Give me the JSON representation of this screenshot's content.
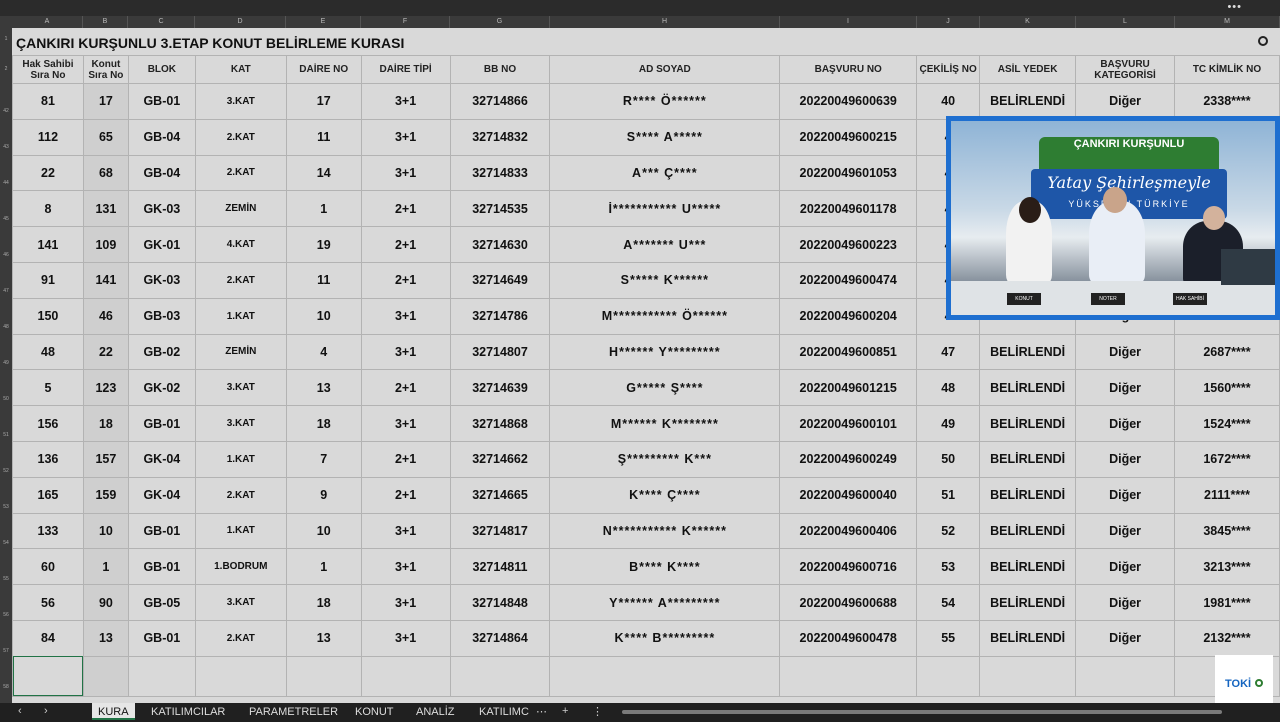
{
  "window": {
    "menu_dots": "•••"
  },
  "sheet_title": "ÇANKIRI KURŞUNLU 3.ETAP KONUT BELİRLEME KURASI",
  "column_letters": [
    "A",
    "B",
    "C",
    "D",
    "E",
    "F",
    "G",
    "H",
    "I",
    "J",
    "K",
    "L",
    "M"
  ],
  "row_numbers": [
    "1",
    "2",
    "42",
    "43",
    "44",
    "45",
    "46",
    "47",
    "48",
    "49",
    "50",
    "51",
    "52",
    "53",
    "54",
    "55",
    "56",
    "57",
    "58"
  ],
  "headers": [
    "Hak Sahibi Sıra No",
    "Konut Sıra No",
    "BLOK",
    "KAT",
    "DAİRE NO",
    "DAİRE TİPİ",
    "BB NO",
    "AD SOYAD",
    "BAŞVURU NO",
    "ÇEKİLİŞ NO",
    "ASİL YEDEK",
    "BAŞVURU KATEGORİSİ",
    "TC KİMLİK NO"
  ],
  "rows": [
    {
      "hak": "81",
      "konut": "17",
      "blok": "GB-01",
      "kat": "3.KAT",
      "daire": "17",
      "tip": "3+1",
      "bb": "32714866",
      "ad": "R**** Ö******",
      "basvuru": "20220049600639",
      "cekilis": "40",
      "asil": "BELİRLENDİ",
      "kategori": "Diğer",
      "tc": "2338****"
    },
    {
      "hak": "112",
      "konut": "65",
      "blok": "GB-04",
      "kat": "2.KAT",
      "daire": "11",
      "tip": "3+1",
      "bb": "32714832",
      "ad": "S**** A*****",
      "basvuru": "20220049600215",
      "cekilis": "4",
      "asil": "",
      "kategori": "",
      "tc": ""
    },
    {
      "hak": "22",
      "konut": "68",
      "blok": "GB-04",
      "kat": "2.KAT",
      "daire": "14",
      "tip": "3+1",
      "bb": "32714833",
      "ad": "A*** Ç****",
      "basvuru": "20220049601053",
      "cekilis": "4",
      "asil": "",
      "kategori": "",
      "tc": ""
    },
    {
      "hak": "8",
      "konut": "131",
      "blok": "GK-03",
      "kat": "ZEMİN",
      "daire": "1",
      "tip": "2+1",
      "bb": "32714535",
      "ad": "İ*********** U*****",
      "basvuru": "20220049601178",
      "cekilis": "4",
      "asil": "",
      "kategori": "",
      "tc": ""
    },
    {
      "hak": "141",
      "konut": "109",
      "blok": "GK-01",
      "kat": "4.KAT",
      "daire": "19",
      "tip": "2+1",
      "bb": "32714630",
      "ad": "A******* U***",
      "basvuru": "20220049600223",
      "cekilis": "4",
      "asil": "",
      "kategori": "",
      "tc": ""
    },
    {
      "hak": "91",
      "konut": "141",
      "blok": "GK-03",
      "kat": "2.KAT",
      "daire": "11",
      "tip": "2+1",
      "bb": "32714649",
      "ad": "S***** K******",
      "basvuru": "20220049600474",
      "cekilis": "4",
      "asil": "",
      "kategori": "",
      "tc": ""
    },
    {
      "hak": "150",
      "konut": "46",
      "blok": "GB-03",
      "kat": "1.KAT",
      "daire": "10",
      "tip": "3+1",
      "bb": "32714786",
      "ad": "M*********** Ö******",
      "basvuru": "20220049600204",
      "cekilis": "4",
      "asil": "",
      "kategori": "Diğer",
      "tc": ""
    },
    {
      "hak": "48",
      "konut": "22",
      "blok": "GB-02",
      "kat": "ZEMİN",
      "daire": "4",
      "tip": "3+1",
      "bb": "32714807",
      "ad": "H****** Y*********",
      "basvuru": "20220049600851",
      "cekilis": "47",
      "asil": "BELİRLENDİ",
      "kategori": "Diğer",
      "tc": "2687****"
    },
    {
      "hak": "5",
      "konut": "123",
      "blok": "GK-02",
      "kat": "3.KAT",
      "daire": "13",
      "tip": "2+1",
      "bb": "32714639",
      "ad": "G***** Ş****",
      "basvuru": "20220049601215",
      "cekilis": "48",
      "asil": "BELİRLENDİ",
      "kategori": "Diğer",
      "tc": "1560****"
    },
    {
      "hak": "156",
      "konut": "18",
      "blok": "GB-01",
      "kat": "3.KAT",
      "daire": "18",
      "tip": "3+1",
      "bb": "32714868",
      "ad": "M****** K********",
      "basvuru": "20220049600101",
      "cekilis": "49",
      "asil": "BELİRLENDİ",
      "kategori": "Diğer",
      "tc": "1524****"
    },
    {
      "hak": "136",
      "konut": "157",
      "blok": "GK-04",
      "kat": "1.KAT",
      "daire": "7",
      "tip": "2+1",
      "bb": "32714662",
      "ad": "Ş********* K***",
      "basvuru": "20220049600249",
      "cekilis": "50",
      "asil": "BELİRLENDİ",
      "kategori": "Diğer",
      "tc": "1672****"
    },
    {
      "hak": "165",
      "konut": "159",
      "blok": "GK-04",
      "kat": "2.KAT",
      "daire": "9",
      "tip": "2+1",
      "bb": "32714665",
      "ad": "K**** Ç****",
      "basvuru": "20220049600040",
      "cekilis": "51",
      "asil": "BELİRLENDİ",
      "kategori": "Diğer",
      "tc": "2111****"
    },
    {
      "hak": "133",
      "konut": "10",
      "blok": "GB-01",
      "kat": "1.KAT",
      "daire": "10",
      "tip": "3+1",
      "bb": "32714817",
      "ad": "N*********** K******",
      "basvuru": "20220049600406",
      "cekilis": "52",
      "asil": "BELİRLENDİ",
      "kategori": "Diğer",
      "tc": "3845****"
    },
    {
      "hak": "60",
      "konut": "1",
      "blok": "GB-01",
      "kat": "1.BODRUM",
      "daire": "1",
      "tip": "3+1",
      "bb": "32714811",
      "ad": "B**** K****",
      "basvuru": "20220049600716",
      "cekilis": "53",
      "asil": "BELİRLENDİ",
      "kategori": "Diğer",
      "tc": "3213****"
    },
    {
      "hak": "56",
      "konut": "90",
      "blok": "GB-05",
      "kat": "3.KAT",
      "daire": "18",
      "tip": "3+1",
      "bb": "32714848",
      "ad": "Y****** A*********",
      "basvuru": "20220049600688",
      "cekilis": "54",
      "asil": "BELİRLENDİ",
      "kategori": "Diğer",
      "tc": "1981****"
    },
    {
      "hak": "84",
      "konut": "13",
      "blok": "GB-01",
      "kat": "2.KAT",
      "daire": "13",
      "tip": "3+1",
      "bb": "32714864",
      "ad": "K**** B*********",
      "basvuru": "20220049600478",
      "cekilis": "55",
      "asil": "BELİRLENDİ",
      "kategori": "Diğer",
      "tc": "2132****"
    }
  ],
  "video": {
    "banner_title": "ÇANKIRI KURŞUNLU",
    "slogan": "Yatay Şehirleşmeyle",
    "subtitle": "YÜKSELEN TÜRKİYE",
    "tags": [
      "KONUT",
      "NOTER",
      "HAK SAHİBİ"
    ]
  },
  "logo": "TOKİ",
  "tabs": [
    "KURA",
    "KATILIMCILAR",
    "PARAMETRELER",
    "KONUT",
    "ANALİZ",
    "KATILIMC"
  ],
  "active_tab": "KURA",
  "nav": {
    "prev": "‹",
    "next": "›",
    "more": "⋯",
    "add": "+",
    "menu": "⋮"
  }
}
